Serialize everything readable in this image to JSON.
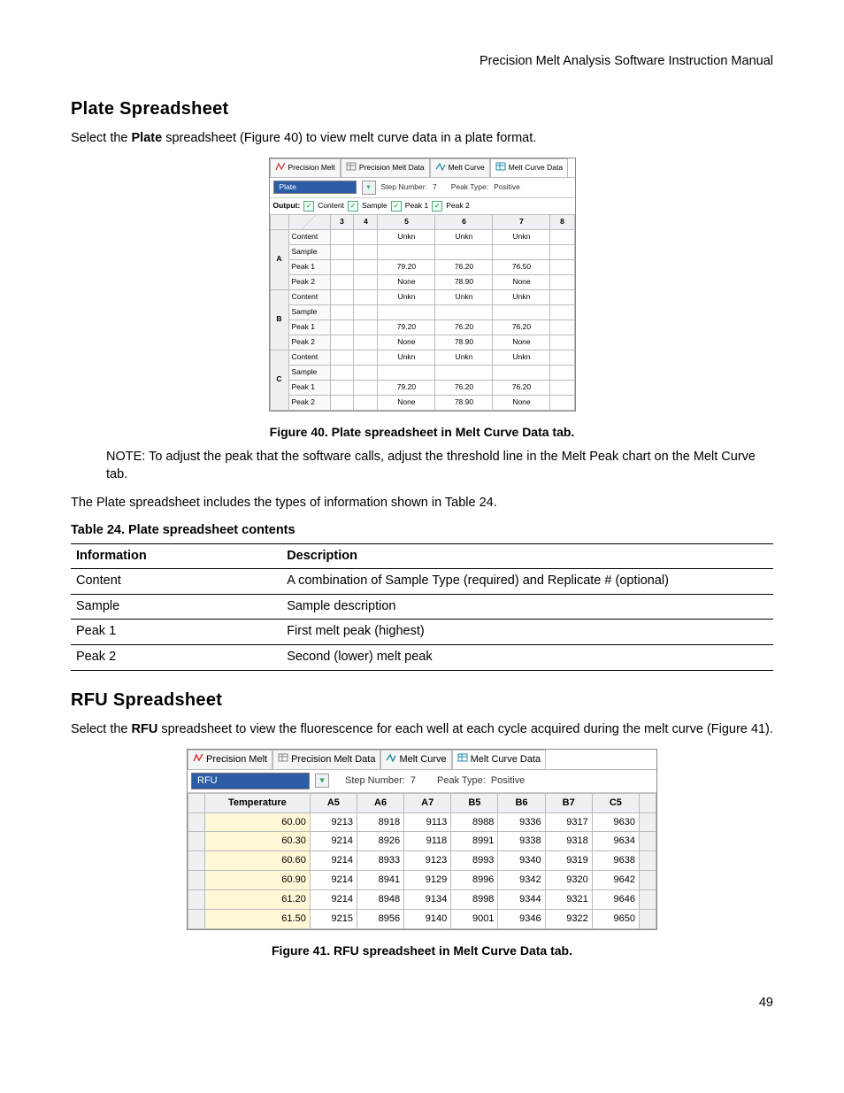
{
  "header": {
    "title": "Precision Melt Analysis Software Instruction Manual"
  },
  "section1": {
    "heading": "Plate Spreadsheet",
    "intro_pre": "Select the ",
    "intro_bold": "Plate",
    "intro_post": " spreadsheet (Figure 40) to view melt curve data in a plate format.",
    "fig_caption": "Figure 40. Plate spreadsheet in Melt Curve Data tab.",
    "note": "NOTE: To adjust the peak that the software calls, adjust the threshold line in the Melt Peak chart on the Melt Curve tab.",
    "para2": "The Plate spreadsheet includes the types of information shown in Table 24.",
    "table_title": "Table 24. Plate spreadsheet contents"
  },
  "table24": {
    "headers": {
      "c1": "Information",
      "c2": "Description"
    },
    "rows": [
      {
        "c1": "Content",
        "c2": "A combination of Sample Type (required) and Replicate # (optional)"
      },
      {
        "c1": "Sample",
        "c2": "Sample description"
      },
      {
        "c1": "Peak 1",
        "c2": "First melt peak (highest)"
      },
      {
        "c1": "Peak 2",
        "c2": "Second (lower) melt peak"
      }
    ]
  },
  "section2": {
    "heading": "RFU Spreadsheet",
    "intro_pre": "Select the ",
    "intro_bold": "RFU",
    "intro_post": " spreadsheet to view the fluorescence for each well at each cycle acquired during the melt curve (Figure 41).",
    "fig_caption": "Figure 41. RFU spreadsheet in Melt Curve Data tab."
  },
  "page_number": "49",
  "ss_tabs": {
    "t1": "Precision Melt",
    "t2": "Precision Melt Data",
    "t3": "Melt Curve",
    "t4": "Melt Curve Data"
  },
  "ss1": {
    "selector": "Plate",
    "step_label": "Step Number:",
    "step_val": "7",
    "peak_type_label": "Peak Type:",
    "peak_type_val": "Positive",
    "output_label": "Output:",
    "chk1": "Content",
    "chk2": "Sample",
    "chk3": "Peak 1",
    "chk4": "Peak 2",
    "cols": [
      "3",
      "4",
      "5",
      "6",
      "7",
      "8"
    ],
    "row_labels": [
      "Content",
      "Sample",
      "Peak 1",
      "Peak 2"
    ],
    "rows": [
      {
        "hdr": "A",
        "r": [
          [
            "",
            "",
            "Unkn",
            "Unkn",
            "Unkn",
            ""
          ],
          [
            "",
            "",
            "",
            "",
            "",
            ""
          ],
          [
            "",
            "",
            "79.20",
            "76.20",
            "76.50",
            ""
          ],
          [
            "",
            "",
            "None",
            "78.90",
            "None",
            ""
          ]
        ]
      },
      {
        "hdr": "B",
        "r": [
          [
            "",
            "",
            "Unkn",
            "Unkn",
            "Unkn",
            ""
          ],
          [
            "",
            "",
            "",
            "",
            "",
            ""
          ],
          [
            "",
            "",
            "79.20",
            "76.20",
            "76.20",
            ""
          ],
          [
            "",
            "",
            "None",
            "78.90",
            "None",
            ""
          ]
        ]
      },
      {
        "hdr": "C",
        "r": [
          [
            "",
            "",
            "Unkn",
            "Unkn",
            "Unkn",
            ""
          ],
          [
            "",
            "",
            "",
            "",
            "",
            ""
          ],
          [
            "",
            "",
            "79.20",
            "76.20",
            "76.20",
            ""
          ],
          [
            "",
            "",
            "None",
            "78.90",
            "None",
            ""
          ]
        ]
      }
    ]
  },
  "ss2": {
    "selector": "RFU",
    "step_label": "Step Number:",
    "step_val": "7",
    "peak_type_label": "Peak Type:",
    "peak_type_val": "Positive",
    "cols": [
      "Temperature",
      "A5",
      "A6",
      "A7",
      "B5",
      "B6",
      "B7",
      "C5"
    ],
    "rows": [
      [
        "60.00",
        "9213",
        "8918",
        "9113",
        "8988",
        "9336",
        "9317",
        "9630"
      ],
      [
        "60.30",
        "9214",
        "8926",
        "9118",
        "8991",
        "9338",
        "9318",
        "9634"
      ],
      [
        "60.60",
        "9214",
        "8933",
        "9123",
        "8993",
        "9340",
        "9319",
        "9638"
      ],
      [
        "60.90",
        "9214",
        "8941",
        "9129",
        "8996",
        "9342",
        "9320",
        "9642"
      ],
      [
        "61.20",
        "9214",
        "8948",
        "9134",
        "8998",
        "9344",
        "9321",
        "9646"
      ],
      [
        "61.50",
        "9215",
        "8956",
        "9140",
        "9001",
        "9346",
        "9322",
        "9650"
      ]
    ]
  }
}
